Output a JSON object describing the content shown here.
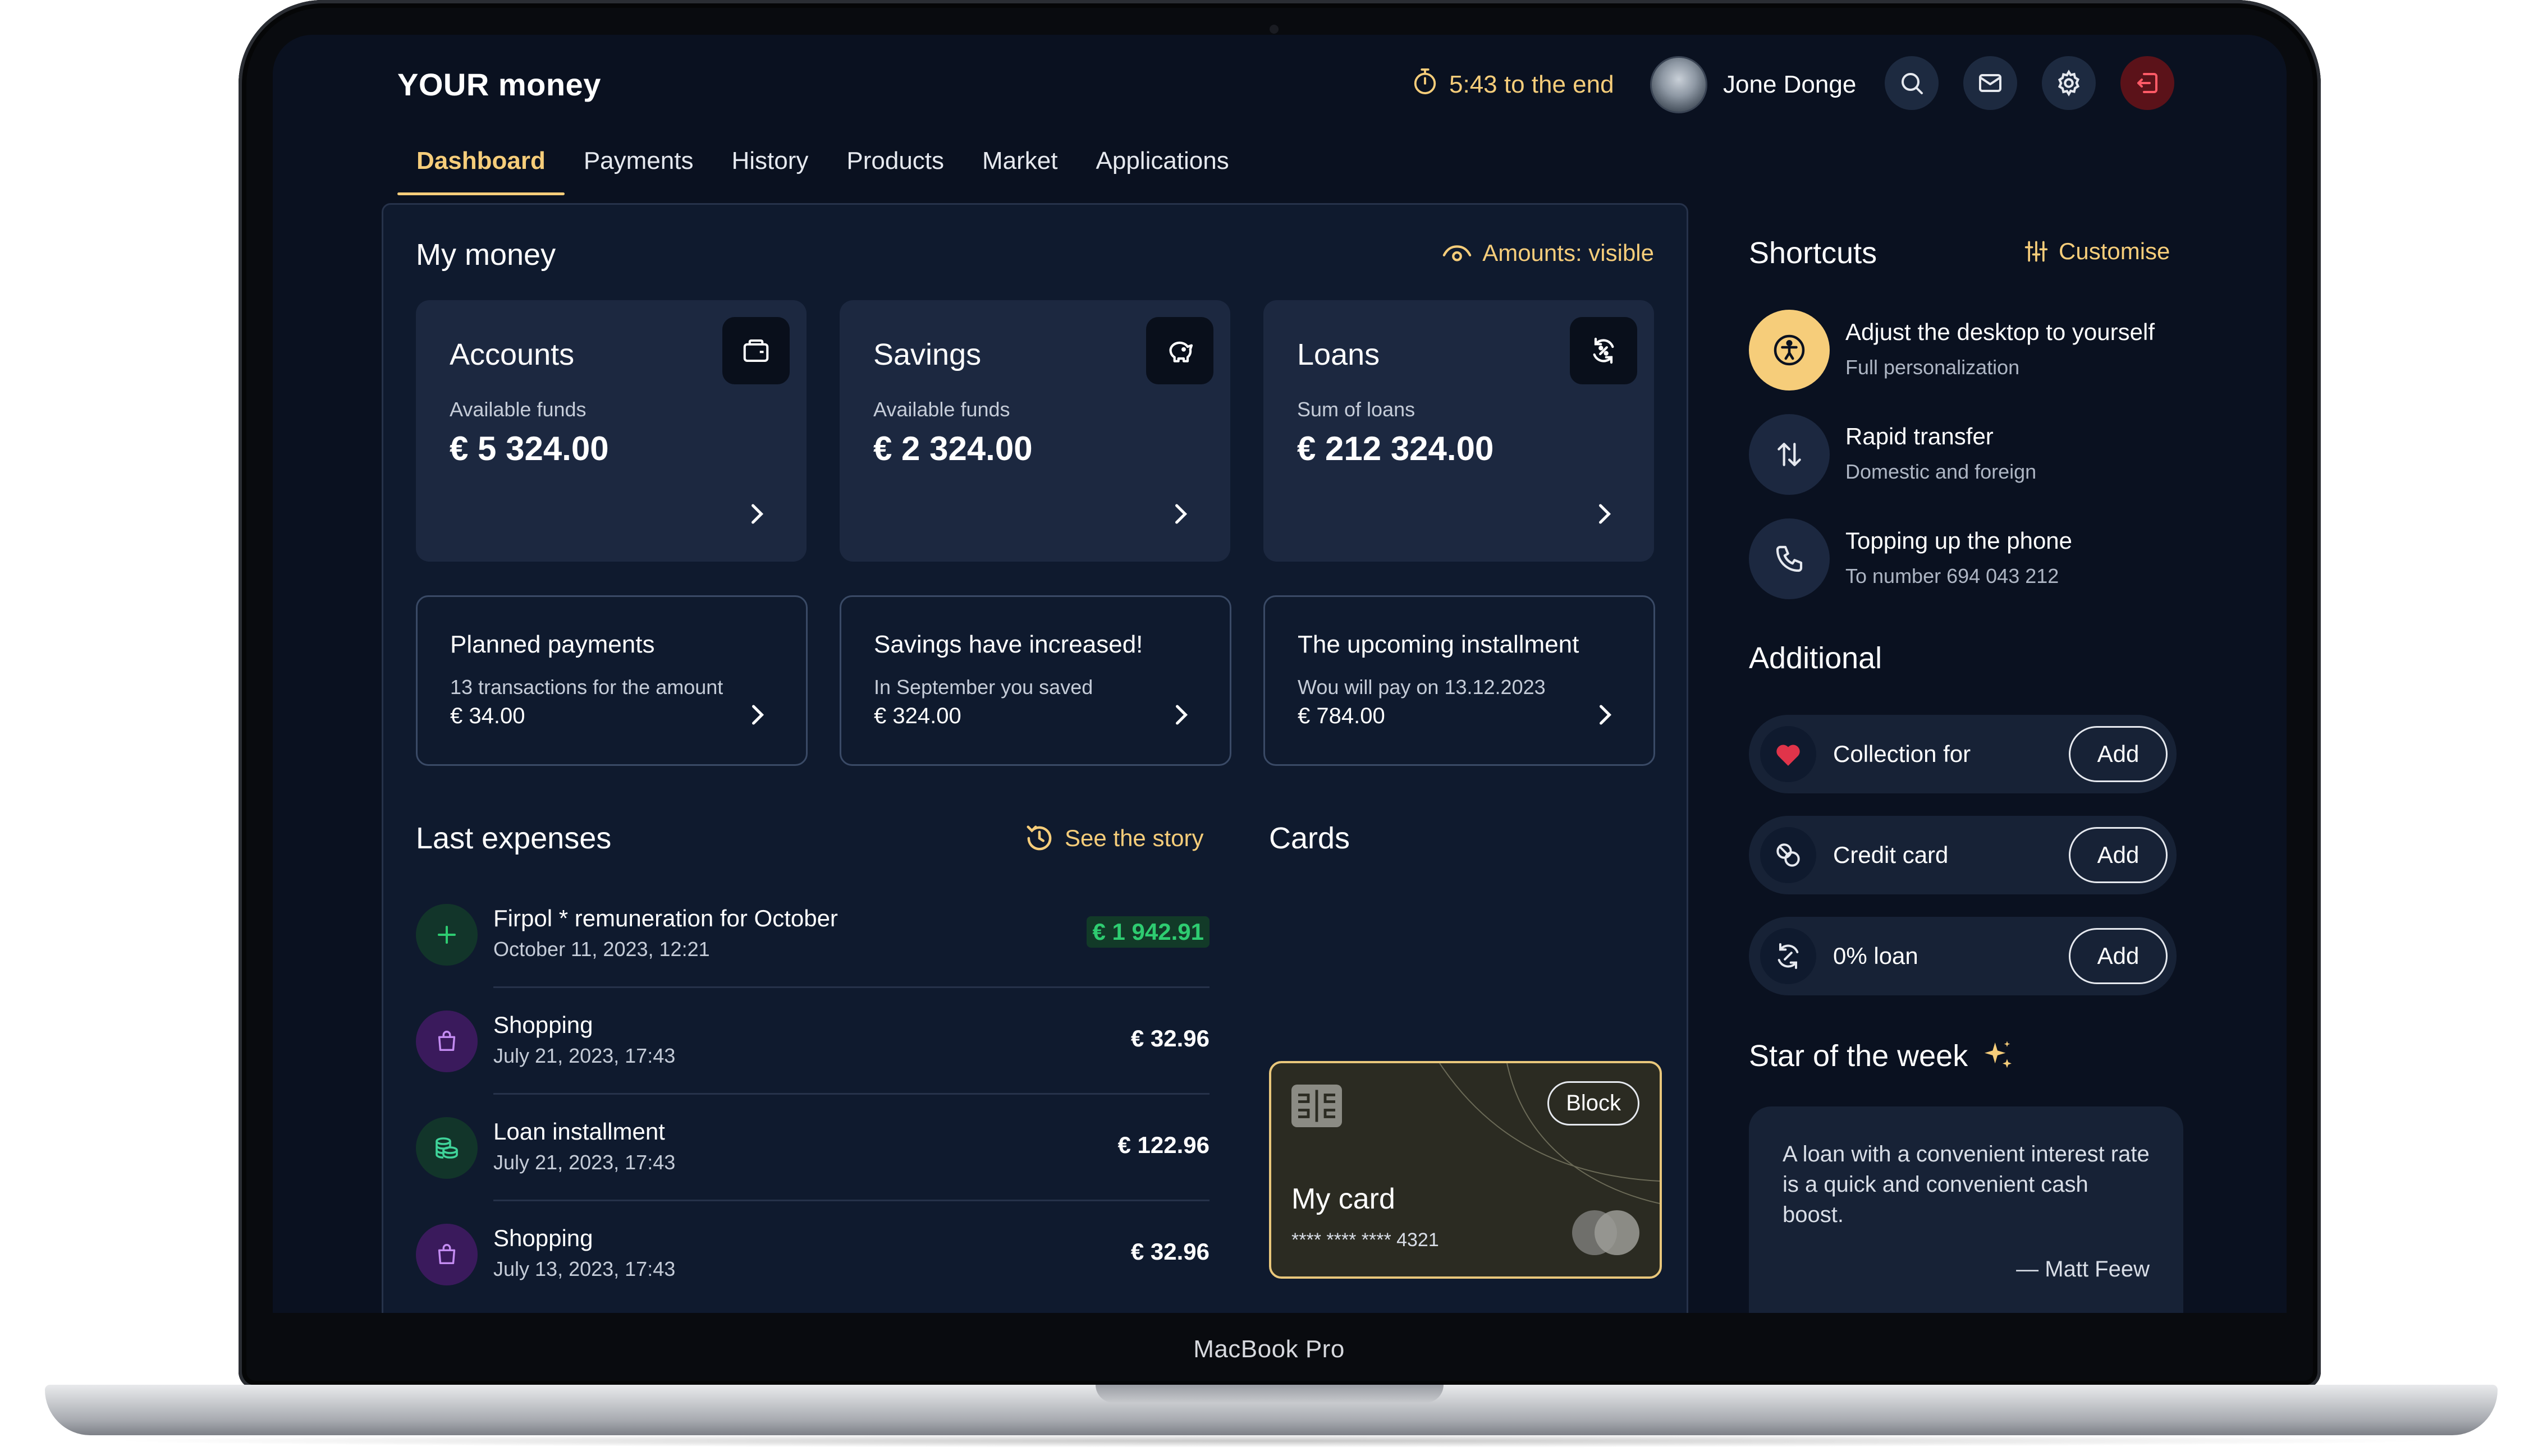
{
  "device": {
    "model": "MacBook Pro"
  },
  "header": {
    "brand": "YOUR money",
    "timer": "5:43 to the end",
    "user_name": "Jone Donge"
  },
  "tabs": [
    {
      "label": "Dashboard",
      "active": true
    },
    {
      "label": "Payments"
    },
    {
      "label": "History"
    },
    {
      "label": "Products"
    },
    {
      "label": "Market"
    },
    {
      "label": "Applications"
    }
  ],
  "my_money": {
    "title": "My money",
    "amounts_toggle": "Amounts: visible",
    "cards": [
      {
        "title": "Accounts",
        "subtitle": "Available funds",
        "amount": "€ 5 324.00",
        "icon": "wallet-icon"
      },
      {
        "title": "Savings",
        "subtitle": "Available funds",
        "amount": "€ 2 324.00",
        "icon": "piggy-bank-icon"
      },
      {
        "title": "Loans",
        "subtitle": "Sum of loans",
        "amount": "€ 212 324.00",
        "icon": "loan-cycle-icon"
      }
    ],
    "info_cards": [
      {
        "title": "Planned payments",
        "subtitle": "13 transactions for the amount",
        "amount": "€ 34.00"
      },
      {
        "title": "Savings have increased!",
        "subtitle": "In September you saved",
        "amount": "€ 324.00"
      },
      {
        "title": "The upcoming installment",
        "subtitle": "Wou will pay on 13.12.2023",
        "amount": "€ 784.00"
      }
    ]
  },
  "expenses": {
    "title": "Last expenses",
    "story_link": "See the story",
    "items": [
      {
        "name": "Firpol * remuneration for October",
        "date": "October 11, 2023, 12:21",
        "amount": "€ 1 942.91",
        "type": "income",
        "icon": "plus-icon"
      },
      {
        "name": "Shopping",
        "date": "July 21, 2023, 17:43",
        "amount": "€ 32.96",
        "type": "shopping",
        "icon": "shopping-bag-icon"
      },
      {
        "name": "Loan installment",
        "date": "July 21, 2023, 17:43",
        "amount": "€ 122.96",
        "type": "loan",
        "icon": "coins-stack-icon"
      },
      {
        "name": "Shopping",
        "date": "July 13, 2023, 17:43",
        "amount": "€ 32.96",
        "type": "shopping",
        "icon": "shopping-bag-icon"
      }
    ]
  },
  "cards_section": {
    "title": "Cards",
    "card": {
      "name": "My card",
      "number": "**** **** **** 4321",
      "block_label": "Block"
    }
  },
  "shortcuts": {
    "title": "Shortcuts",
    "customise_label": "Customise",
    "items": [
      {
        "title": "Adjust the desktop to yourself",
        "subtitle": "Full personalization",
        "icon": "accessibility-icon"
      },
      {
        "title": "Rapid transfer",
        "subtitle": "Domestic and foreign",
        "icon": "transfer-arrows-icon"
      },
      {
        "title": "Topping up the phone",
        "subtitle": "To number 694 043 212",
        "icon": "phone-icon"
      }
    ]
  },
  "additional": {
    "title": "Additional",
    "items": [
      {
        "label": "Collection for",
        "button": "Add",
        "icon": "heart-icon"
      },
      {
        "label": "Credit card",
        "button": "Add",
        "icon": "credit-card-icon"
      },
      {
        "label": "0% loan",
        "button": "Add",
        "icon": "loan-cycle-icon"
      }
    ]
  },
  "star_of_week": {
    "title": "Star of the week",
    "quote": "A loan with a convenient interest rate is a quick and convenient cash boost.",
    "author": "— Matt Feew"
  },
  "colors": {
    "background": "#0a1120",
    "panel": "#0f1a2e",
    "card": "#1c2840",
    "accent": "#f6cd7a",
    "income": "#2ecc71",
    "shopping": "#8e3bd6",
    "logout": "#5b1219"
  }
}
